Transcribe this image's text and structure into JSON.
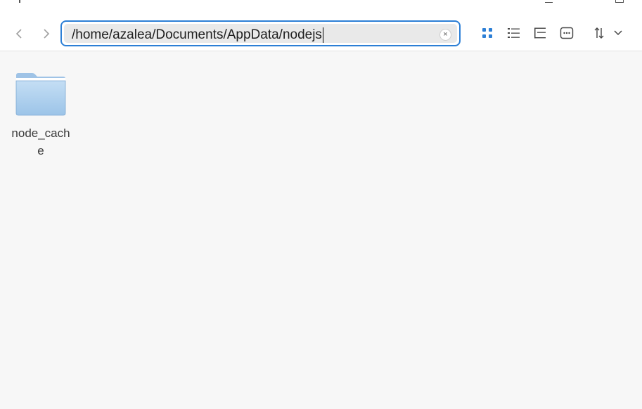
{
  "toolbar": {
    "address_path": "/home/azalea/Documents/AppData/nodejs",
    "clear_glyph": "×"
  },
  "icons": {
    "back": "chevron-left-icon",
    "forward": "chevron-right-icon",
    "icon_view": "grid-view-icon",
    "list_view": "list-view-icon",
    "tree_view": "tree-view-icon",
    "more": "more-options-icon",
    "sort": "sort-icon",
    "folder": "folder-icon"
  },
  "colors": {
    "accent": "#2c7fd6",
    "folder_body": "#a8cdee",
    "background": "#f7f7f7"
  },
  "files": [
    {
      "name": "node_cache",
      "type": "folder"
    }
  ]
}
